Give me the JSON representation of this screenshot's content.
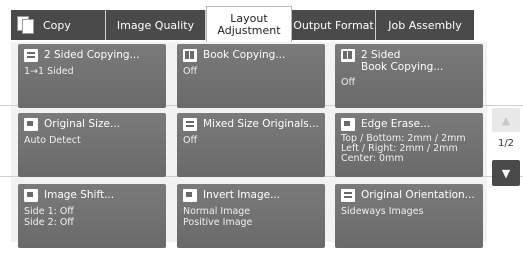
{
  "tabs": [
    {
      "label": "Copy"
    },
    {
      "label": "Image Quality"
    },
    {
      "label": "Layout Adjustment"
    },
    {
      "label": "Output Format"
    },
    {
      "label": "Job Assembly"
    }
  ],
  "tiles": [
    {
      "title": "2 Sided Copying...",
      "value": "1→1 Sided",
      "icon": "two-sided-icon"
    },
    {
      "title": "Book Copying...",
      "value": "Off",
      "icon": "book-copying-icon"
    },
    {
      "title": "2 Sided\nBook Copying...",
      "value": "Off",
      "icon": "two-sided-book-icon"
    },
    {
      "title": "Original Size...",
      "value": "Auto Detect",
      "icon": "original-size-icon"
    },
    {
      "title": "Mixed Size Originals...",
      "value": "Off",
      "icon": "mixed-size-icon"
    },
    {
      "title": "Edge Erase...",
      "value": "Top / Bottom: 2mm / 2mm\nLeft / Right: 2mm / 2mm\nCenter: 0mm",
      "icon": "edge-erase-icon"
    },
    {
      "title": "Image Shift...",
      "value": "Side 1: Off\nSide 2: Off",
      "icon": "image-shift-icon"
    },
    {
      "title": "Invert Image...",
      "value": "Normal Image\nPositive Image",
      "icon": "invert-image-icon"
    },
    {
      "title": "Original Orientation...",
      "value": "Sideways Images",
      "icon": "original-orientation-icon"
    }
  ],
  "pager": {
    "page": "1/2",
    "up": "▲",
    "down": "▼"
  }
}
